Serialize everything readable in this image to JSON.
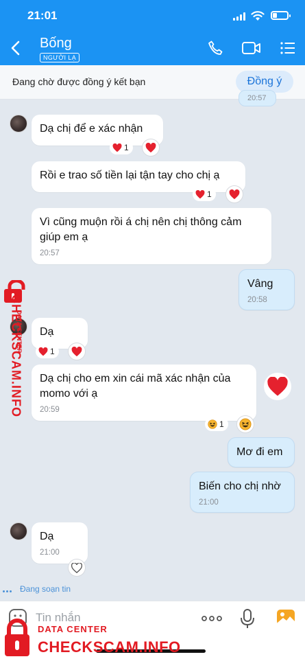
{
  "status": {
    "time": "21:01"
  },
  "header": {
    "name": "Bống",
    "badge": "NGƯỜI LẠ"
  },
  "friend_request": {
    "text": "Đang chờ được đồng ý kết bạn",
    "button": "Đồng ý"
  },
  "messages": [
    {
      "side": "them",
      "text": "Dạ chị để e xác nhận",
      "reaction_count": "1"
    },
    {
      "side": "them",
      "text": "Rồi e trao số tiền lại tận tay cho chị ạ",
      "reaction_count": "1"
    },
    {
      "side": "them",
      "text": "Vì cũng muộn rồi á chị nên chị thông cảm\ngiúp em ạ",
      "time": "20:57"
    },
    {
      "side": "me",
      "text": "Vâng",
      "time": "20:58"
    },
    {
      "side": "them",
      "text": "Dạ",
      "reaction_count": "1"
    },
    {
      "side": "them",
      "text": "Dạ chị cho em xin cái mã xác nhận của\nmomo với ạ",
      "time": "20:59",
      "reaction_count": "1"
    },
    {
      "side": "me",
      "text": "Mơ đi em"
    },
    {
      "side": "me",
      "text": "Biến cho chị nhờ",
      "time": "21:00"
    },
    {
      "side": "them",
      "text": "Dạ",
      "time": "21:00"
    }
  ],
  "typing": "Đang soạn tin",
  "input": {
    "placeholder": "Tin nhắn"
  },
  "watermark": {
    "sub": "DATA CENTER",
    "main": "CHECKSCAM.INFO"
  },
  "colors": {
    "header": "#1b93f3",
    "my_bubble": "#d8edfc",
    "heart": "#e5212e",
    "watermark": "#e21b23"
  },
  "icons": [
    "back-icon",
    "phone-icon",
    "video-call-icon",
    "menu-icon",
    "heart-icon",
    "haha-icon",
    "emoji-icon",
    "more-icon",
    "mic-icon",
    "image-icon"
  ]
}
